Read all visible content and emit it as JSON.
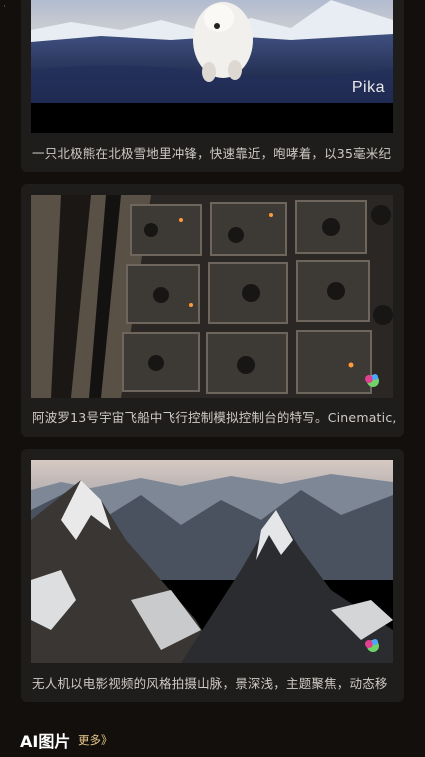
{
  "feed": {
    "items": [
      {
        "caption": "一只北极熊在北极雪地里冲锋，快速靠近，咆哮着，以35毫米纪",
        "watermark": "Pika"
      },
      {
        "caption": "阿波罗13号宇宙飞船中飞行控制模拟控制台的特写。Cinematic,"
      },
      {
        "caption": "无人机以电影视频的风格拍摄山脉，景深浅，主题聚焦，动态移"
      }
    ]
  },
  "section": {
    "title": "AI图片",
    "more_label": "更多》"
  }
}
